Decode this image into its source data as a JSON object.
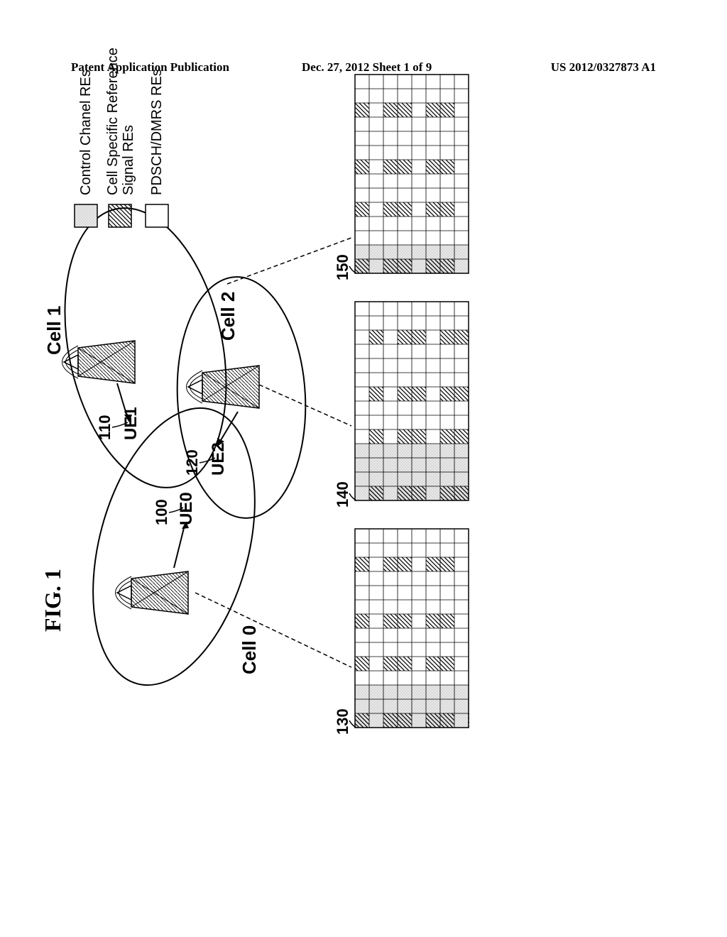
{
  "header": {
    "left": "Patent Application Publication",
    "center": "Dec. 27, 2012  Sheet 1 of 9",
    "right": "US 2012/0327873 A1"
  },
  "figure": {
    "label": "FIG. 1",
    "cells": {
      "cell0": "Cell 0",
      "cell1": "Cell 1",
      "cell2": "Cell 2"
    },
    "ues": {
      "ue0": "UE0",
      "ue1": "UE1",
      "ue2": "UE2"
    },
    "refs": {
      "r100": "100",
      "r110": "110",
      "r120": "120",
      "r130": "130",
      "r140": "140",
      "r150": "150"
    },
    "legend": {
      "control": "Control Chanel REs",
      "crs": "Cell Specific Reference Signal REs",
      "pdsch": "PDSCH/DMRS REs"
    }
  }
}
